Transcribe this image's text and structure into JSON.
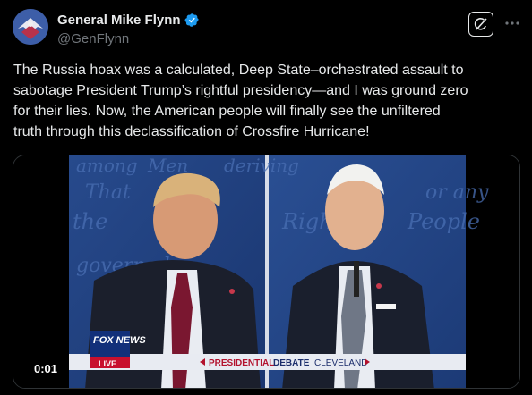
{
  "author": {
    "display_name": "General Mike Flynn",
    "handle": "@GenFlynn",
    "verified": true,
    "verified_color": "#1d9bf0"
  },
  "tweet": {
    "text": "The Russia hoax was a calculated, Deep State–orchestrated assault to\nsabotage President Trump’s rightful presidency—and I was ground zero\nfor their lies. Now, the American people will finally see the unfiltered\ntruth through this declassification of Crossfire Hurricane!"
  },
  "media": {
    "duration": "0:01",
    "network_logo": "FOX NEWS",
    "network_live": "LIVE",
    "banner_left": "PRESIDENTIAL",
    "banner_mid": "DEBATE",
    "banner_right": "CLEVELAND",
    "backdrop_words": [
      "among",
      "Men",
      "deriving",
      "That",
      "or any",
      "the",
      "Right",
      "People",
      "governed"
    ]
  },
  "icons": {
    "grok": "grok-icon",
    "more": "more-dots-icon",
    "verified": "verified-badge-icon"
  }
}
